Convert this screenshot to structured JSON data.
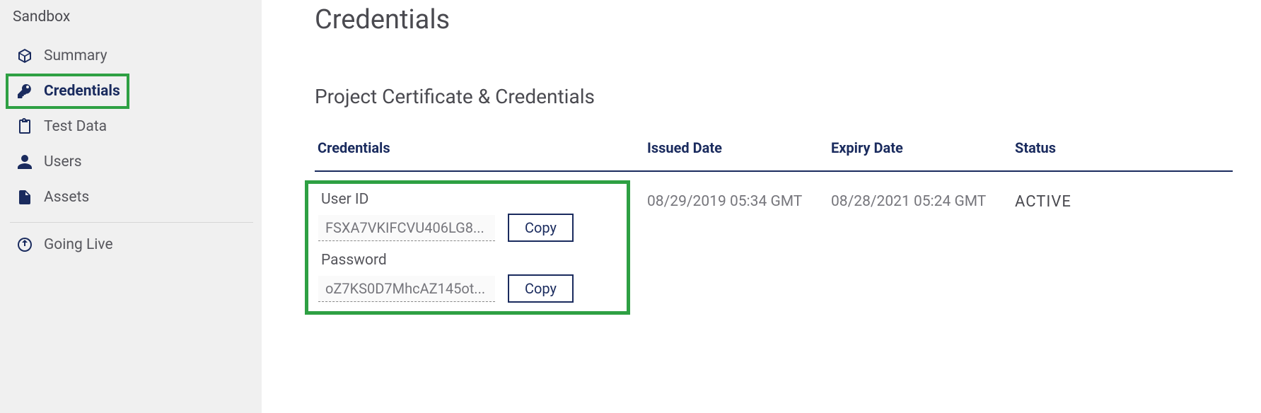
{
  "sidebar": {
    "header": "Sandbox",
    "items": [
      {
        "label": "Summary"
      },
      {
        "label": "Credentials"
      },
      {
        "label": "Test Data"
      },
      {
        "label": "Users"
      },
      {
        "label": "Assets"
      },
      {
        "label": "Going Live"
      }
    ]
  },
  "page": {
    "title": "Credentials",
    "section_title": "Project Certificate & Credentials"
  },
  "table": {
    "headers": {
      "credentials": "Credentials",
      "issued": "Issued Date",
      "expiry": "Expiry Date",
      "status": "Status"
    },
    "row": {
      "user_id_label": "User ID",
      "user_id_value": "FSXA7VKIFCVU406LG8...",
      "password_label": "Password",
      "password_value": "oZ7KS0D7MhcAZ145ot...",
      "copy_label": "Copy",
      "issued": "08/29/2019 05:34 GMT",
      "expiry": "08/28/2021 05:24 GMT",
      "status": "ACTIVE"
    }
  }
}
